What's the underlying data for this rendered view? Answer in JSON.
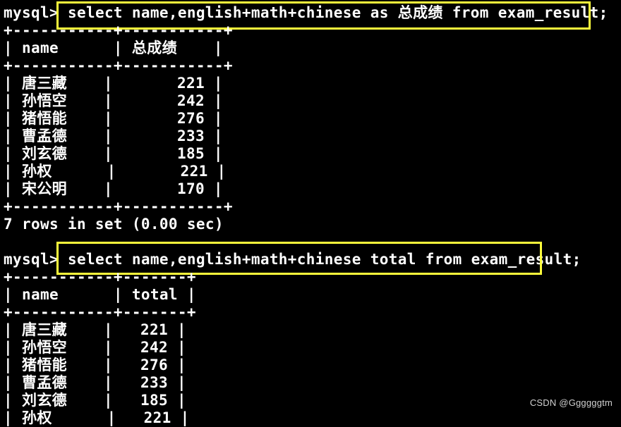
{
  "prompt": "mysql>",
  "block1": {
    "command": "select name,english+math+chinese as 总成绩 from exam_result;",
    "border": "+-----------+-----------+",
    "header": "| name      | 总成绩    |",
    "rows": [
      "| 唐三藏    |       221 |",
      "| 孙悟空    |       242 |",
      "| 猪悟能    |       276 |",
      "| 曹孟德    |       233 |",
      "| 刘玄德    |       185 |",
      "| 孙权      |       221 |",
      "| 宋公明    |       170 |"
    ],
    "footer": "7 rows in set (0.00 sec)"
  },
  "block2": {
    "command": "select name,english+math+chinese total from exam_result;",
    "border": "+-----------+-------+",
    "header": "| name      | total |",
    "rows": [
      "| 唐三藏    |   221 |",
      "| 孙悟空    |   242 |",
      "| 猪悟能    |   276 |",
      "| 曹孟德    |   233 |",
      "| 刘玄德    |   185 |",
      "| 孙权      |   221 |"
    ]
  },
  "watermark": "CSDN @Ggggggtm",
  "colors": {
    "background": "#000000",
    "text": "#ffffff",
    "highlight": "#ffff3c"
  }
}
